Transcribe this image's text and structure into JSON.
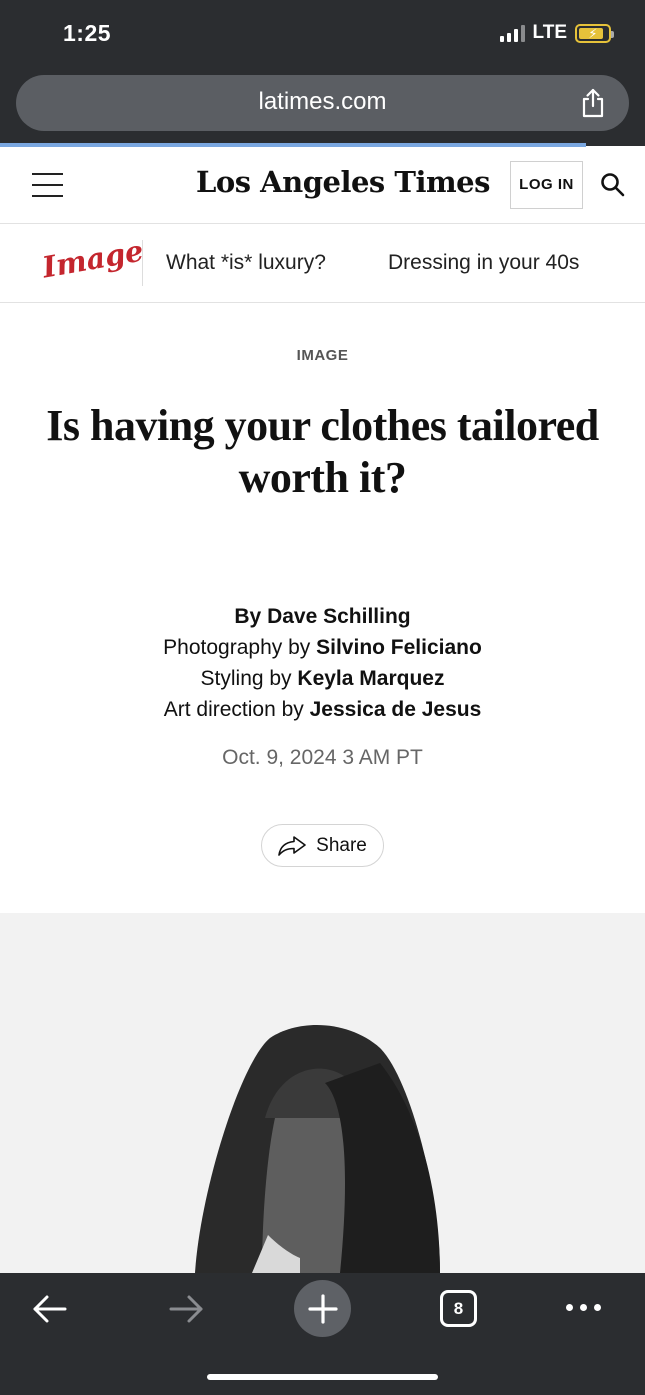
{
  "status_bar": {
    "time": "1:25",
    "network": "LTE"
  },
  "browser": {
    "url": "latimes.com",
    "tab_count": "8"
  },
  "site": {
    "logo": "Los Angeles Times",
    "login_label": "LOG IN"
  },
  "section_nav": {
    "section_logo": "Image",
    "links": [
      "What *is* luxury?",
      "Dressing in your 40s"
    ]
  },
  "article": {
    "kicker": "IMAGE",
    "headline": "Is having your clothes tailored worth it?",
    "byline_prefix": "By",
    "author": "Dave Schilling",
    "photo_prefix": "Photography by",
    "photographer": "Silvino Feliciano",
    "styling_prefix": "Styling by",
    "stylist": "Keyla Marquez",
    "art_prefix": "Art direction by",
    "art_director": "Jessica de Jesus",
    "date": "Oct. 9, 2024 3 AM PT",
    "share_label": "Share"
  },
  "colors": {
    "chrome": "#2b2d30",
    "brand_red": "#c4262e",
    "battery": "#e6c23a"
  }
}
